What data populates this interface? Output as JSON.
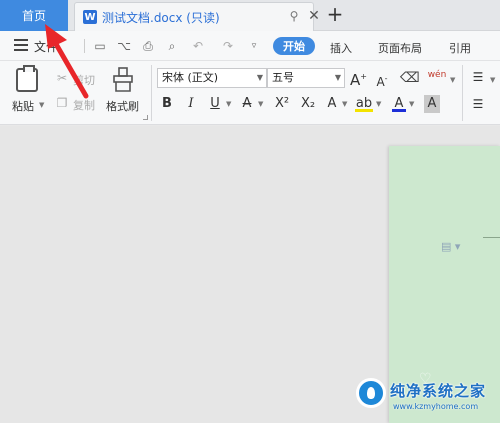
{
  "tabs": {
    "home_label": "首页",
    "doc_title": "测试文档.docx (只读)",
    "doc_icon_letter": "W",
    "close_glyph": "✕",
    "pin_glyph": "⚲",
    "new_tab_glyph": "+"
  },
  "menu": {
    "file_label": "文件",
    "tabs": [
      "开始",
      "插入",
      "页面布局",
      "引用"
    ]
  },
  "ribbon": {
    "paste_label": "粘贴",
    "cut_label": "剪切",
    "copy_label": "复制",
    "format_painter_label": "格式刷",
    "font_name": "宋体 (正文)",
    "font_size": "五号",
    "grow_font": "A",
    "shrink_font": "A",
    "bold": "B",
    "italic": "I",
    "underline": "U",
    "strike": "A",
    "superscript": "X²",
    "subscript": "X₂",
    "text_effect": "A",
    "highlight": "ab",
    "font_color": "A",
    "char_shading": "A",
    "phonetic": "wén"
  },
  "watermark": {
    "title": "纯净系统之家",
    "url": "www.kzmyhome.com"
  },
  "colors": {
    "accent": "#3f8ae0",
    "page_bg": "#cde8cf",
    "arrow": "#e8262a"
  },
  "icons": [
    "menu-icon",
    "save-icon",
    "undo-icon",
    "redo-icon",
    "print-icon",
    "preview-icon",
    "close-icon",
    "pin-icon",
    "new-tab-icon",
    "paste-icon",
    "scissors-icon",
    "copy-icon",
    "brush-icon",
    "eraser-icon",
    "arrow-annotation"
  ]
}
